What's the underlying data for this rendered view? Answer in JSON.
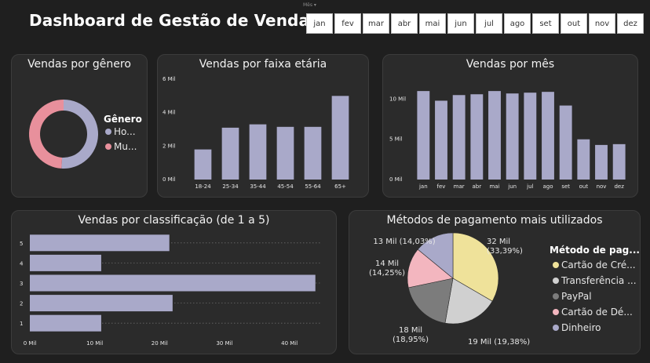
{
  "header": {
    "title": "Dashboard de Gestão de Vendas",
    "slicer_tag": "Mês ▾",
    "months": [
      "jan",
      "fev",
      "mar",
      "abr",
      "mai",
      "jun",
      "jul",
      "ago",
      "set",
      "out",
      "nov",
      "dez"
    ]
  },
  "colors": {
    "background": "#1f1f1f",
    "card": "#2b2b2b",
    "bar": "#a9a9c9",
    "male": "#a9a9c9",
    "female": "#e8909c",
    "pay_credit": "#efe29a",
    "pay_transfer": "#d0d0d0",
    "pay_paypal": "#7c7c7c",
    "pay_debit": "#f3b6bf",
    "pay_cash": "#a9a9c9"
  },
  "chart_data": [
    {
      "id": "gender",
      "type": "pie",
      "title": "Vendas por gênero",
      "legend_title": "Gênero",
      "labels": [
        "Ho...",
        "Mu..."
      ],
      "values": [
        51,
        49
      ]
    },
    {
      "id": "age",
      "type": "bar",
      "title": "Vendas por faixa etária",
      "categories": [
        "18-24",
        "25-34",
        "35-44",
        "45-54",
        "55-64",
        "65+"
      ],
      "values": [
        1800,
        3100,
        3300,
        3150,
        3150,
        5000
      ],
      "yticks": [
        "0 Mil",
        "2 Mil",
        "4 Mil",
        "6 Mil"
      ],
      "ylim": [
        0,
        6000
      ]
    },
    {
      "id": "month",
      "type": "bar",
      "title": "Vendas por mês",
      "categories": [
        "jan",
        "fev",
        "mar",
        "abr",
        "mai",
        "jun",
        "jul",
        "ago",
        "set",
        "out",
        "nov",
        "dez"
      ],
      "values": [
        11000,
        9800,
        10500,
        10600,
        11000,
        10700,
        10800,
        10900,
        9200,
        5000,
        4300,
        4400
      ],
      "yticks": [
        "0 Mil",
        "5 Mil",
        "10 Mil"
      ],
      "ylim": [
        0,
        11500
      ]
    },
    {
      "id": "rating",
      "type": "bar",
      "orientation": "horizontal",
      "title": "Vendas por classificação (de 1 a 5)",
      "categories": [
        "5",
        "4",
        "3",
        "2",
        "1"
      ],
      "values": [
        21500,
        11000,
        44000,
        22000,
        11000
      ],
      "xticks": [
        "0 Mil",
        "10 Mil",
        "20 Mil",
        "30 Mil",
        "40 Mil"
      ],
      "xlim": [
        0,
        45000
      ]
    },
    {
      "id": "payment",
      "type": "pie",
      "title": "Métodos de pagamento mais utilizados",
      "legend_title": "Método de pag...",
      "labels": [
        "Cartão de Cré...",
        "Transferência ...",
        "PayPal",
        "Cartão de Dé...",
        "Dinheiro"
      ],
      "values": [
        33.39,
        19.38,
        18.95,
        14.25,
        14.03
      ],
      "data_labels": [
        [
          "32 Mil",
          "(33,39%)"
        ],
        [
          "19 Mil (19,38%)"
        ],
        [
          "18 Mil",
          "(18,95%)"
        ],
        [
          "14 Mil",
          "(14,25%)"
        ],
        [
          "13 Mil (14,03%)"
        ]
      ]
    }
  ]
}
